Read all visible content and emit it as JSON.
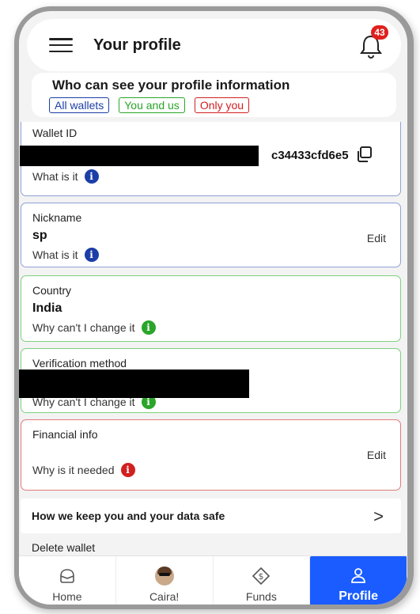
{
  "header": {
    "title": "Your profile",
    "notification_count": "43"
  },
  "visibility": {
    "title": "Who can see your profile information",
    "options": [
      {
        "label": "All wallets",
        "color": "#1c3ea8"
      },
      {
        "label": "You and us",
        "color": "#2aa52a"
      },
      {
        "label": "Only you",
        "color": "#d21f1f"
      }
    ]
  },
  "wallet": {
    "label": "Wallet ID",
    "id_visible_tail": "c34433cfd6e5",
    "help": "What is it"
  },
  "nickname": {
    "label": "Nickname",
    "value": "sp",
    "edit": "Edit",
    "help": "What is it"
  },
  "country": {
    "label": "Country",
    "value": "India",
    "help": "Why can't I change it"
  },
  "verification": {
    "label": "Verification method",
    "help": "Why can't I change it"
  },
  "financial": {
    "label": "Financial info",
    "edit": "Edit",
    "help": "Why is it needed"
  },
  "safety": {
    "label": "How we keep you and your data safe"
  },
  "delete_wallet": {
    "label": "Delete wallet"
  },
  "nav": {
    "home": "Home",
    "caira": "Caira!",
    "funds": "Funds",
    "profile": "Profile"
  },
  "colors": {
    "accent": "#1a5cff",
    "blue": "#1c3ea8",
    "green": "#2aa52a",
    "red": "#d21f1f",
    "badge": "#e0201c"
  }
}
